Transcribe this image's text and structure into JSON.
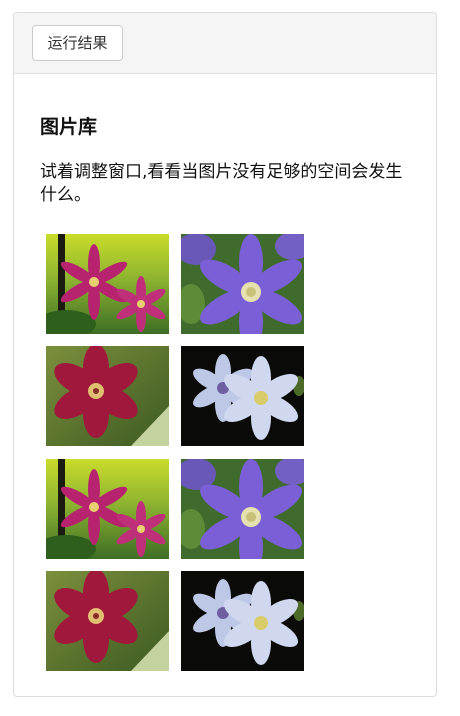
{
  "toolbar": {
    "run_result_label": "运行结果"
  },
  "main": {
    "title": "图片库",
    "description": "试着调整窗口,看看当图片没有足够的空间会发生什么。"
  },
  "gallery": {
    "images": [
      {
        "kind": "pink-clematis"
      },
      {
        "kind": "purple-clematis"
      },
      {
        "kind": "red-clematis"
      },
      {
        "kind": "white-blue-clematis"
      },
      {
        "kind": "pink-clematis"
      },
      {
        "kind": "purple-clematis"
      },
      {
        "kind": "red-clematis"
      },
      {
        "kind": "white-blue-clematis"
      }
    ]
  },
  "colors": {
    "header_bg": "#f5f5f5",
    "border": "#dcdcdc",
    "text": "#111111"
  }
}
